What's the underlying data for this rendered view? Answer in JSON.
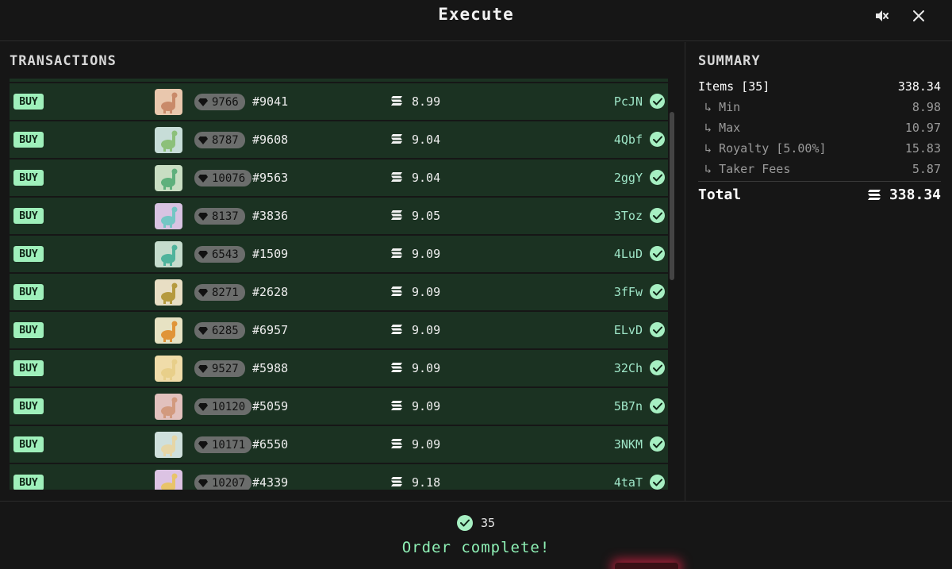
{
  "header": {
    "title": "Execute",
    "mute_icon": "speaker-mute-icon",
    "close_icon": "close-icon"
  },
  "transactions": {
    "title": "TRANSACTIONS",
    "rows": [
      {
        "action": "BUY",
        "rank": "9766",
        "token": "#9041",
        "price": "8.99",
        "sig": "PcJN",
        "thumb": "#e9c7ad",
        "dino": "#c98a6a"
      },
      {
        "action": "BUY",
        "rank": "8787",
        "token": "#9608",
        "price": "9.04",
        "sig": "4Qbf",
        "thumb": "#c7ddd8",
        "dino": "#8cc07a"
      },
      {
        "action": "BUY",
        "rank": "10076",
        "token": "#9563",
        "price": "9.04",
        "sig": "2ggY",
        "thumb": "#c9dec3",
        "dino": "#5fb07c"
      },
      {
        "action": "BUY",
        "rank": "8137",
        "token": "#3836",
        "price": "9.05",
        "sig": "3Toz",
        "thumb": "#d8c3e2",
        "dino": "#74c6c4"
      },
      {
        "action": "BUY",
        "rank": "6543",
        "token": "#1509",
        "price": "9.09",
        "sig": "4LuD",
        "thumb": "#c5dccd",
        "dino": "#4fb39c"
      },
      {
        "action": "BUY",
        "rank": "8271",
        "token": "#2628",
        "price": "9.09",
        "sig": "3fFw",
        "thumb": "#e8dec4",
        "dino": "#b59a3f"
      },
      {
        "action": "BUY",
        "rank": "6285",
        "token": "#6957",
        "price": "9.09",
        "sig": "ELvD",
        "thumb": "#e7e2c3",
        "dino": "#e09438"
      },
      {
        "action": "BUY",
        "rank": "9527",
        "token": "#5988",
        "price": "9.09",
        "sig": "32Ch",
        "thumb": "#f0dca9",
        "dino": "#e8cf8a"
      },
      {
        "action": "BUY",
        "rank": "10120",
        "token": "#5059",
        "price": "9.09",
        "sig": "5B7n",
        "thumb": "#e2c1bd",
        "dino": "#d29a7e"
      },
      {
        "action": "BUY",
        "rank": "10171",
        "token": "#6550",
        "price": "9.09",
        "sig": "3NKM",
        "thumb": "#cfe0dc",
        "dino": "#e6d6a6"
      },
      {
        "action": "BUY",
        "rank": "10207",
        "token": "#4339",
        "price": "9.18",
        "sig": "4taT",
        "thumb": "#dcc3e3",
        "dino": "#e8c46a"
      }
    ]
  },
  "summary": {
    "title": "SUMMARY",
    "items_label": "Items [35]",
    "items_value": "338.34",
    "min_label": "Min",
    "min_value": "8.98",
    "max_label": "Max",
    "max_value": "10.97",
    "royalty_label": "Royalty [5.00%]",
    "royalty_value": "15.83",
    "taker_label": "Taker Fees",
    "taker_value": "5.87",
    "total_label": "Total",
    "total_value": "338.34",
    "sub_prefix": "↳"
  },
  "footer": {
    "count": "35",
    "message": "Order complete!"
  },
  "colors": {
    "row_bg": "#1b3222",
    "accent": "#9ff0bb",
    "signature": "#9fe6c8"
  }
}
